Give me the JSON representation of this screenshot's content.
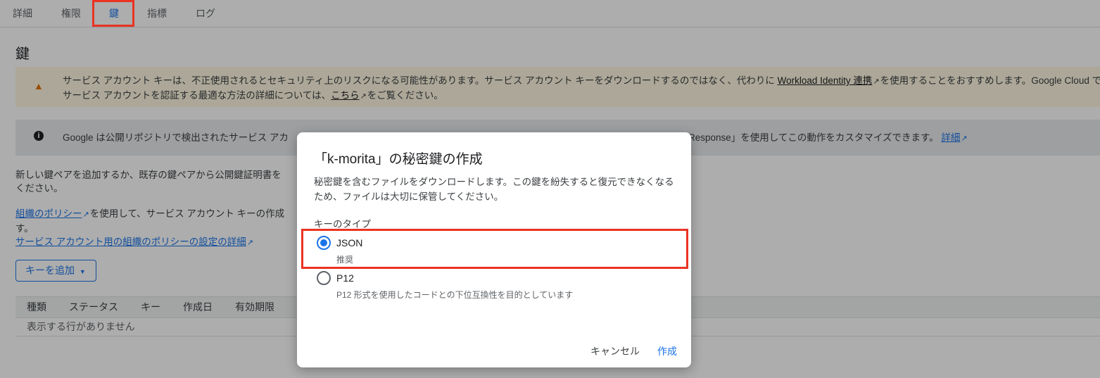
{
  "tabs": [
    "詳細",
    "権限",
    "鍵",
    "指標",
    "ログ"
  ],
  "page_title": "鍵",
  "warning": {
    "text1": "サービス アカウント キーは、不正使用されるとセキュリティ上のリスクになる可能性があります。サービス アカウント キーをダウンロードするのではなく、代わりに ",
    "link1": "Workload Identity 連携",
    "text2": "を使用することをおすすめします。Google Cloud で",
    "text3": "サービス アカウントを認証する最適な方法の詳細については、",
    "link2": "こちら",
    "text4": "をご覧ください。"
  },
  "info": {
    "text_left": "Google は公開リポジトリで検出されたサービス アカ",
    "text_right": "Response」を使用してこの動作をカスタマイズできます。",
    "link": "詳細"
  },
  "add_key_desc": {
    "line1": "新しい鍵ペアを追加するか、既存の鍵ペアから公開鍵証明書を",
    "line2": "ください。"
  },
  "policy": {
    "link1": "組織のポリシー",
    "text1": "を使用して、サービス アカウント キーの作成",
    "text2": "す。",
    "link2": "サービス アカウント用の組織のポリシーの設定の詳細"
  },
  "add_key_button": "キーを追加",
  "table": {
    "headers": [
      "種類",
      "ステータス",
      "キー",
      "作成日",
      "有効期限"
    ],
    "empty_message": "表示する行がありません"
  },
  "dialog": {
    "title": "「k-morita」の秘密鍵の作成",
    "description": "秘密鍵を含むファイルをダウンロードします。この鍵を紛失すると復元できなくなるため、ファイルは大切に保管してください。",
    "key_type_label": "キーのタイプ",
    "options": [
      {
        "label": "JSON",
        "sub": "推奨",
        "selected": true
      },
      {
        "label": "P12",
        "sub": "P12 形式を使用したコードとの下位互換性を目的としています",
        "selected": false
      }
    ],
    "cancel": "キャンセル",
    "create": "作成"
  }
}
